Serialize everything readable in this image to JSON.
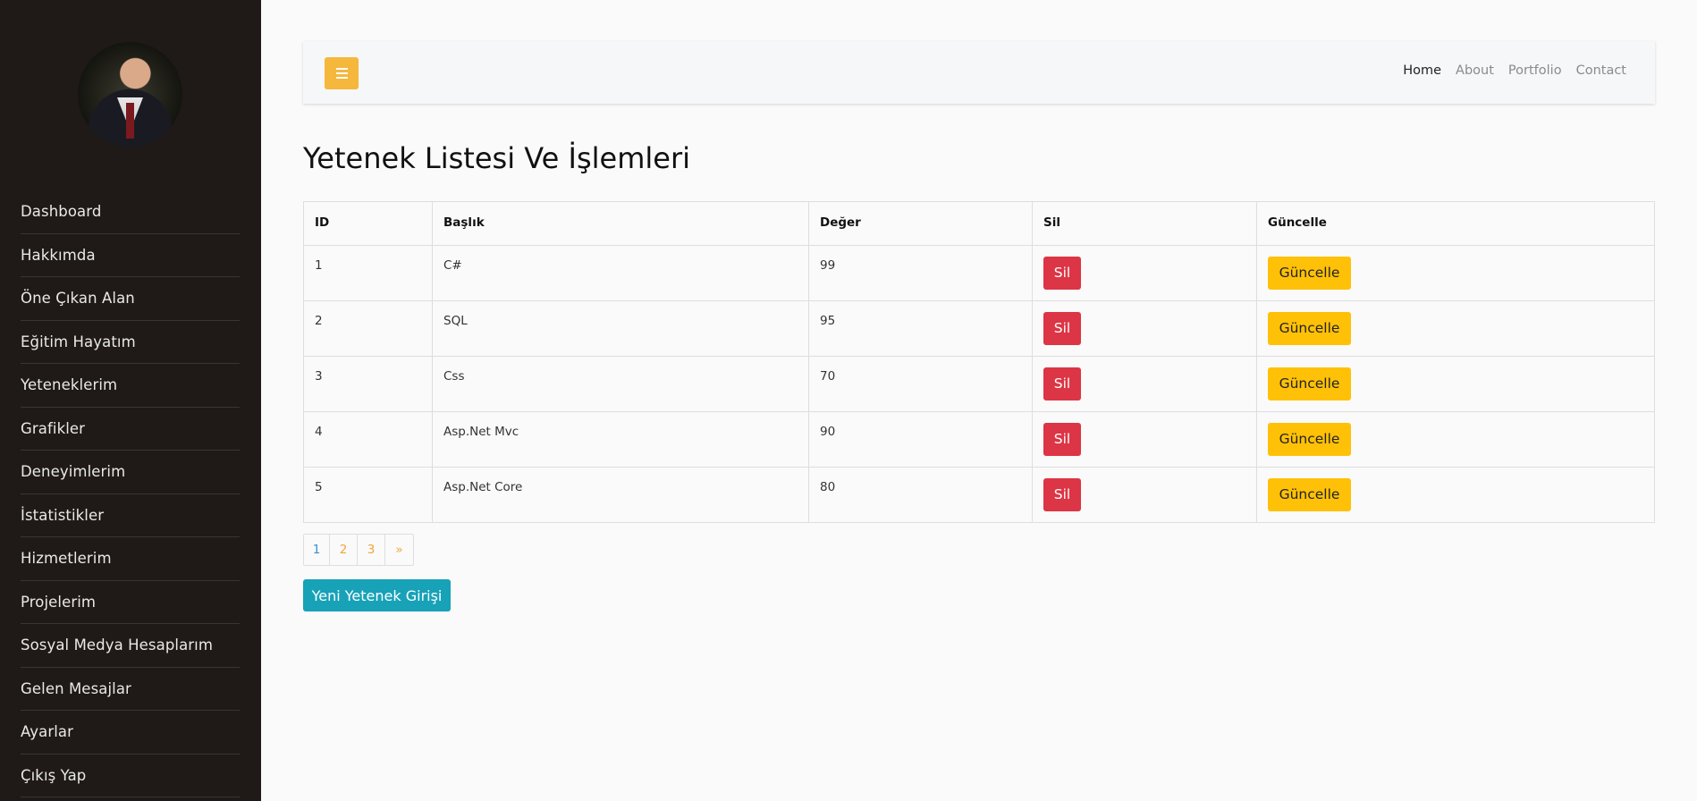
{
  "sidebar": {
    "items": [
      {
        "label": "Dashboard"
      },
      {
        "label": "Hakkımda"
      },
      {
        "label": "Öne Çıkan Alan"
      },
      {
        "label": "Eğitim Hayatım"
      },
      {
        "label": "Yeteneklerim"
      },
      {
        "label": "Grafikler"
      },
      {
        "label": "Deneyimlerim"
      },
      {
        "label": "İstatistikler"
      },
      {
        "label": "Hizmetlerim"
      },
      {
        "label": "Projelerim"
      },
      {
        "label": "Sosyal Medya Hesaplarım"
      },
      {
        "label": "Gelen Mesajlar"
      },
      {
        "label": "Ayarlar"
      },
      {
        "label": "Çıkış Yap"
      }
    ]
  },
  "topbar": {
    "menu_icon": "bars-icon",
    "nav": [
      {
        "label": "Home",
        "active": true
      },
      {
        "label": "About"
      },
      {
        "label": "Portfolio"
      },
      {
        "label": "Contact"
      }
    ]
  },
  "page": {
    "title": "Yetenek Listesi Ve İşlemleri"
  },
  "table": {
    "headers": [
      "ID",
      "Başlık",
      "Değer",
      "Sil",
      "Güncelle"
    ],
    "rows": [
      {
        "id": "1",
        "title": "C#",
        "value": "99",
        "delete": "Sil",
        "update": "Güncelle"
      },
      {
        "id": "2",
        "title": "SQL",
        "value": "95",
        "delete": "Sil",
        "update": "Güncelle"
      },
      {
        "id": "3",
        "title": "Css",
        "value": "70",
        "delete": "Sil",
        "update": "Güncelle"
      },
      {
        "id": "4",
        "title": "Asp.Net Mvc",
        "value": "90",
        "delete": "Sil",
        "update": "Güncelle"
      },
      {
        "id": "5",
        "title": "Asp.Net Core",
        "value": "80",
        "delete": "Sil",
        "update": "Güncelle"
      }
    ]
  },
  "pagination": {
    "pages": [
      "1",
      "2",
      "3",
      "»"
    ],
    "current": "1"
  },
  "actions": {
    "new_label": "Yeni Yetenek Girişi"
  },
  "colors": {
    "sidebar_bg": "#1f1a17",
    "accent": "#f5b73c",
    "danger": "#dc3545",
    "warning": "#ffc107",
    "info": "#17a2b8"
  }
}
